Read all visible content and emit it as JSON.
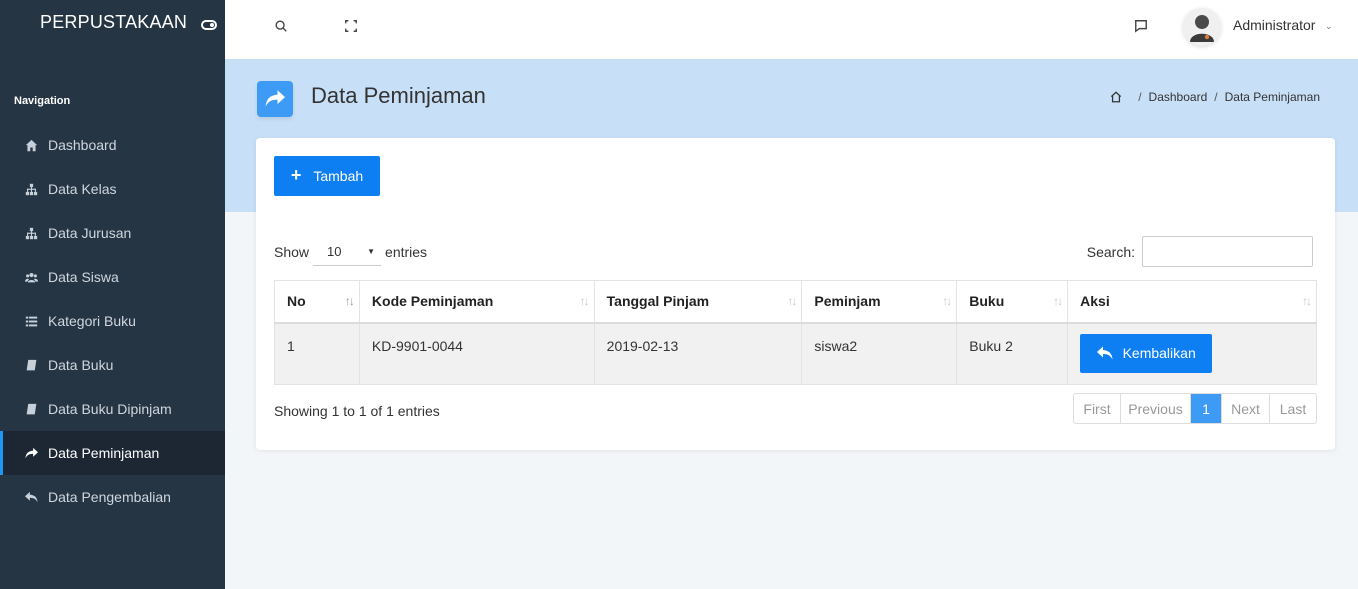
{
  "sidebar": {
    "brand": "PERPUSTAKAAN",
    "caption": "Navigation",
    "items": [
      {
        "label": "Dashboard",
        "icon": "home-icon"
      },
      {
        "label": "Data Kelas",
        "icon": "sitemap-icon"
      },
      {
        "label": "Data Jurusan",
        "icon": "sitemap-icon"
      },
      {
        "label": "Data Siswa",
        "icon": "users-icon"
      },
      {
        "label": "Kategori Buku",
        "icon": "list-icon"
      },
      {
        "label": "Data Buku",
        "icon": "book-icon"
      },
      {
        "label": "Data Buku Dipinjam",
        "icon": "book-icon"
      },
      {
        "label": "Data Peminjaman",
        "icon": "share-icon",
        "active": true
      },
      {
        "label": "Data Pengembalian",
        "icon": "reply-icon"
      }
    ]
  },
  "topbar": {
    "user": "Administrator"
  },
  "header": {
    "title": "Data Peminjaman",
    "breadcrumb": [
      "Dashboard",
      "Data Peminjaman"
    ]
  },
  "card": {
    "add_label": "Tambah",
    "show_label": "Show",
    "entries_label": "entries",
    "length_value": "10",
    "search_label": "Search:",
    "search_value": "",
    "columns": [
      "No",
      "Kode Peminjaman",
      "Tanggal Pinjam",
      "Peminjam",
      "Buku",
      "Aksi"
    ],
    "rows": [
      {
        "no": "1",
        "kode": "KD-9901-0044",
        "tanggal": "2019-02-13",
        "peminjam": "siswa2",
        "buku": "Buku 2",
        "aksi": "Kembalikan"
      }
    ],
    "info": "Showing 1 to 1 of 1 entries",
    "pagination": [
      "First",
      "Previous",
      "1",
      "Next",
      "Last"
    ]
  },
  "colors": {
    "sidebar_bg": "#263544",
    "accent": "#0d7ff2",
    "header_band": "#c8e0f7"
  }
}
